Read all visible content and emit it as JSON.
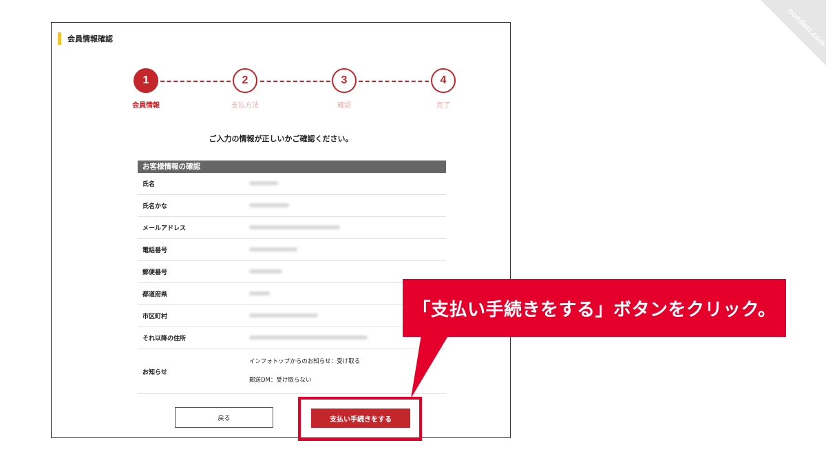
{
  "watermark": "nondori.com",
  "section": {
    "title": "会員情報確認"
  },
  "steps": [
    {
      "number": "1",
      "label": "会員情報",
      "state": "active"
    },
    {
      "number": "2",
      "label": "支払方法",
      "state": "inactive"
    },
    {
      "number": "3",
      "label": "確認",
      "state": "inactive"
    },
    {
      "number": "4",
      "label": "完了",
      "state": "inactive"
    }
  ],
  "instruction": "ご入力の情報が正しいかご確認ください。",
  "table": {
    "header": "お客様情報の確認",
    "rows": [
      {
        "label": "氏名"
      },
      {
        "label": "氏名かな"
      },
      {
        "label": "メールアドレス"
      },
      {
        "label": "電話番号"
      },
      {
        "label": "郵便番号"
      },
      {
        "label": "都道府県"
      },
      {
        "label": "市区町村"
      },
      {
        "label": "それ以降の住所"
      },
      {
        "label": "お知らせ"
      }
    ],
    "notices": [
      "インフォトップからのお知らせ：受け取る",
      "郵送DM：受け取らない"
    ]
  },
  "buttons": {
    "back": "戻る",
    "pay": "支払い手続きをする"
  },
  "callout": {
    "text": "「支払い手続きをする」ボタンをクリック。"
  },
  "colors": {
    "accent": "#c3272b",
    "annotation": "#e4002b",
    "section_bar": "#f2c230",
    "table_header": "#666666"
  }
}
